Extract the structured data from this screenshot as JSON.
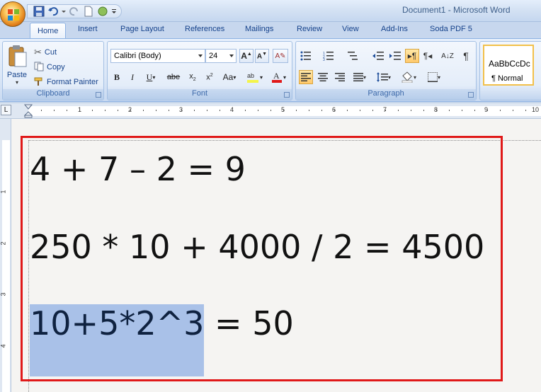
{
  "window": {
    "title": "Document1 - Microsoft Word"
  },
  "tabs": [
    "Home",
    "Insert",
    "Page Layout",
    "References",
    "Mailings",
    "Review",
    "View",
    "Add-Ins",
    "Soda PDF 5"
  ],
  "ribbon": {
    "clipboard": {
      "group_label": "Clipboard",
      "paste": "Paste",
      "cut": "Cut",
      "copy": "Copy",
      "format_painter": "Format Painter"
    },
    "font": {
      "group_label": "Font",
      "font_name": "Calibri (Body)",
      "font_size": "24",
      "change_case": "Aa"
    },
    "paragraph": {
      "group_label": "Paragraph"
    },
    "styles": {
      "sample": "AaBbCcDc",
      "normal": "¶ Normal"
    }
  },
  "ruler": {
    "labels": [
      "1",
      "2",
      "3",
      "4",
      "5",
      "6",
      "7",
      "8",
      "9",
      "10"
    ],
    "tab_selector": "L"
  },
  "document": {
    "line1": "4 + 7 – 2 = 9",
    "line2": "250 * 10 + 4000 / 2 = 4500",
    "line3_selected": "10+5*2^3",
    "line3_rest": " = 50"
  },
  "colors": {
    "accent": "#15428b",
    "selection": "#a9c1e8",
    "annotation_box": "#e01919"
  }
}
